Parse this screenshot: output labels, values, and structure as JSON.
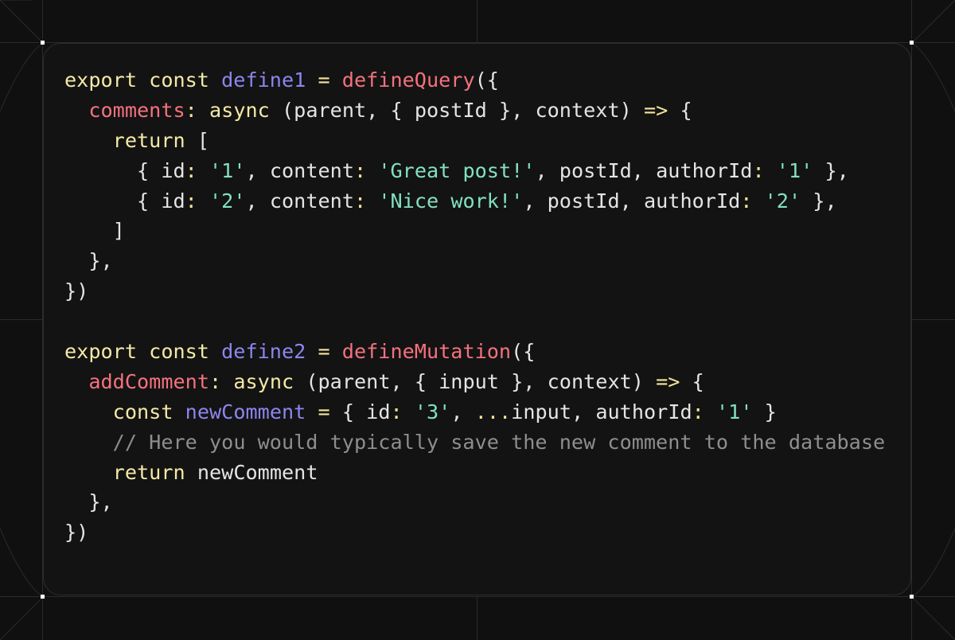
{
  "colors": {
    "background": "#101010",
    "card": "#131313",
    "keyword": "#f4e9a6",
    "identifier": "#8c86ee",
    "function": "#f4727d",
    "string": "#82e0c2",
    "comment": "#8e8e8e",
    "text": "#e4e4e4"
  },
  "code": {
    "lines": [
      [
        {
          "t": "keyword",
          "v": "export const "
        },
        {
          "t": "ident",
          "v": "define1"
        },
        {
          "t": "op",
          "v": " = "
        },
        {
          "t": "func",
          "v": "defineQuery"
        },
        {
          "t": "punct",
          "v": "({"
        }
      ],
      [
        {
          "t": "plain",
          "v": "  "
        },
        {
          "t": "prop",
          "v": "comments"
        },
        {
          "t": "op",
          "v": ": "
        },
        {
          "t": "keyword",
          "v": "async"
        },
        {
          "t": "plain",
          "v": " (parent, { postId }, context) "
        },
        {
          "t": "op",
          "v": "=>"
        },
        {
          "t": "plain",
          "v": " {"
        }
      ],
      [
        {
          "t": "plain",
          "v": "    "
        },
        {
          "t": "keyword",
          "v": "return"
        },
        {
          "t": "plain",
          "v": " ["
        }
      ],
      [
        {
          "t": "plain",
          "v": "      { id"
        },
        {
          "t": "op",
          "v": ": "
        },
        {
          "t": "string",
          "v": "'1'"
        },
        {
          "t": "plain",
          "v": ", content"
        },
        {
          "t": "op",
          "v": ": "
        },
        {
          "t": "string",
          "v": "'Great post!'"
        },
        {
          "t": "plain",
          "v": ", postId, authorId"
        },
        {
          "t": "op",
          "v": ": "
        },
        {
          "t": "string",
          "v": "'1'"
        },
        {
          "t": "plain",
          "v": " },"
        }
      ],
      [
        {
          "t": "plain",
          "v": "      { id"
        },
        {
          "t": "op",
          "v": ": "
        },
        {
          "t": "string",
          "v": "'2'"
        },
        {
          "t": "plain",
          "v": ", content"
        },
        {
          "t": "op",
          "v": ": "
        },
        {
          "t": "string",
          "v": "'Nice work!'"
        },
        {
          "t": "plain",
          "v": ", postId, authorId"
        },
        {
          "t": "op",
          "v": ": "
        },
        {
          "t": "string",
          "v": "'2'"
        },
        {
          "t": "plain",
          "v": " },"
        }
      ],
      [
        {
          "t": "plain",
          "v": "    ]"
        }
      ],
      [
        {
          "t": "plain",
          "v": "  },"
        }
      ],
      [
        {
          "t": "plain",
          "v": "})"
        }
      ],
      [],
      [
        {
          "t": "keyword",
          "v": "export const "
        },
        {
          "t": "ident",
          "v": "define2"
        },
        {
          "t": "op",
          "v": " = "
        },
        {
          "t": "func",
          "v": "defineMutation"
        },
        {
          "t": "punct",
          "v": "({"
        }
      ],
      [
        {
          "t": "plain",
          "v": "  "
        },
        {
          "t": "prop",
          "v": "addComment"
        },
        {
          "t": "op",
          "v": ": "
        },
        {
          "t": "keyword",
          "v": "async"
        },
        {
          "t": "plain",
          "v": " (parent, { input }, context) "
        },
        {
          "t": "op",
          "v": "=>"
        },
        {
          "t": "plain",
          "v": " {"
        }
      ],
      [
        {
          "t": "plain",
          "v": "    "
        },
        {
          "t": "keyword",
          "v": "const"
        },
        {
          "t": "plain",
          "v": " "
        },
        {
          "t": "ident",
          "v": "newComment"
        },
        {
          "t": "op",
          "v": " = "
        },
        {
          "t": "plain",
          "v": "{ id"
        },
        {
          "t": "op",
          "v": ": "
        },
        {
          "t": "string",
          "v": "'3'"
        },
        {
          "t": "plain",
          "v": ", "
        },
        {
          "t": "op",
          "v": "..."
        },
        {
          "t": "plain",
          "v": "input, authorId"
        },
        {
          "t": "op",
          "v": ": "
        },
        {
          "t": "string",
          "v": "'1'"
        },
        {
          "t": "plain",
          "v": " }"
        }
      ],
      [
        {
          "t": "plain",
          "v": "    "
        },
        {
          "t": "comment",
          "v": "// Here you would typically save the new comment to the database"
        }
      ],
      [
        {
          "t": "plain",
          "v": "    "
        },
        {
          "t": "keyword",
          "v": "return"
        },
        {
          "t": "plain",
          "v": " newComment"
        }
      ],
      [
        {
          "t": "plain",
          "v": "  },"
        }
      ],
      [
        {
          "t": "plain",
          "v": "})"
        }
      ]
    ]
  }
}
